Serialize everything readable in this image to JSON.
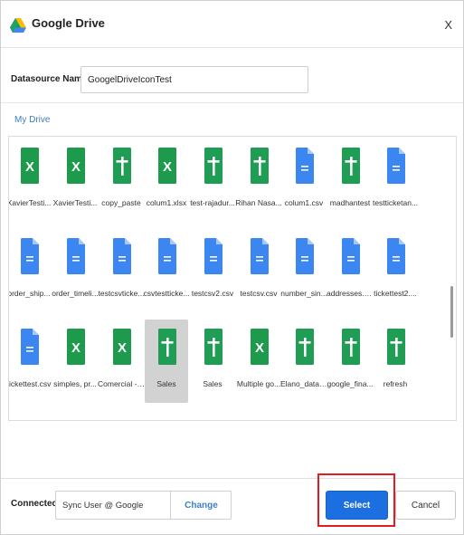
{
  "dialog": {
    "title": "Google Drive",
    "close_label": "X"
  },
  "datasource": {
    "label": "Datasource Name",
    "value": "GoogelDriveIconTest"
  },
  "breadcrumb": "My Drive",
  "colors": {
    "excel": "#1d9a4c",
    "sheets": "#1f9d55",
    "docs": "#3b86f0",
    "selected_bg": "#d2d2d2",
    "accent": "#1c6fe0",
    "highlight": "#e31b23"
  },
  "files": [
    {
      "name": "XavierTesti...",
      "type": "excel"
    },
    {
      "name": "XavierTesti...",
      "type": "excel"
    },
    {
      "name": "copy_paste",
      "type": "sheets"
    },
    {
      "name": "colum1.xlsx",
      "type": "excel"
    },
    {
      "name": "test-rajadur...",
      "type": "sheets"
    },
    {
      "name": "Rihan Nasa...",
      "type": "sheets"
    },
    {
      "name": "colum1.csv",
      "type": "docs"
    },
    {
      "name": "madhantest",
      "type": "sheets"
    },
    {
      "name": "testticketan...",
      "type": "docs"
    },
    {
      "name": "order_ship...",
      "type": "docs"
    },
    {
      "name": "order_timeli...",
      "type": "docs"
    },
    {
      "name": "testcsvticke...",
      "type": "docs"
    },
    {
      "name": "csvtestticke...",
      "type": "docs"
    },
    {
      "name": "testcsv2.csv",
      "type": "docs"
    },
    {
      "name": "testcsv.csv",
      "type": "docs"
    },
    {
      "name": "number_sin...",
      "type": "docs"
    },
    {
      "name": "addresses.c...",
      "type": "docs"
    },
    {
      "name": "tickettest2....",
      "type": "docs"
    },
    {
      "name": "tickettest.csv",
      "type": "docs"
    },
    {
      "name": "simples, pr...",
      "type": "excel"
    },
    {
      "name": "Comercial - ...",
      "type": "excel"
    },
    {
      "name": "Sales",
      "type": "sheets",
      "selected": true
    },
    {
      "name": "Sales",
      "type": "sheets"
    },
    {
      "name": "Multiple go...",
      "type": "excel"
    },
    {
      "name": "Elano_datat...",
      "type": "sheets"
    },
    {
      "name": "google_fina...",
      "type": "sheets"
    },
    {
      "name": "refresh",
      "type": "sheets"
    }
  ],
  "footer": {
    "connected_label": "Connected as:",
    "account": "Sync User @ Google",
    "change_label": "Change",
    "select_label": "Select",
    "cancel_label": "Cancel"
  }
}
